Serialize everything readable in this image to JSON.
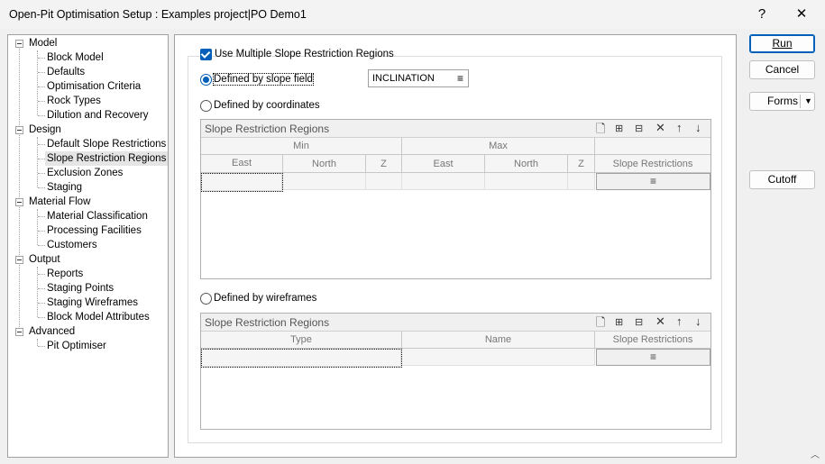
{
  "window": {
    "title": "Open-Pit Optimisation Setup : Examples project|PO Demo1",
    "help": "?",
    "close": "✕"
  },
  "tree": {
    "groups": [
      {
        "label": "Model",
        "items": [
          "Block Model",
          "Defaults",
          "Optimisation Criteria",
          "Rock Types",
          "Dilution and Recovery"
        ]
      },
      {
        "label": "Design",
        "items": [
          "Default Slope Restrictions",
          "Slope Restriction Regions",
          "Exclusion Zones",
          "Staging"
        ]
      },
      {
        "label": "Material Flow",
        "items": [
          "Material Classification",
          "Processing Facilities",
          "Customers"
        ]
      },
      {
        "label": "Output",
        "items": [
          "Reports",
          "Staging Points",
          "Staging Wireframes",
          "Block Model Attributes"
        ]
      },
      {
        "label": "Advanced",
        "items": [
          "Pit Optimiser"
        ]
      }
    ],
    "selected": "Slope Restriction Regions"
  },
  "form": {
    "use_multiple_label": "Use Multiple Slope Restriction Regions",
    "use_multiple_checked": true,
    "opt_slope_field": "Defined by slope field",
    "slope_field_value": "INCLINATION",
    "opt_coordinates": "Defined by coordinates",
    "opt_wireframes": "Defined by wireframes",
    "selected_option": "slope_field"
  },
  "coords_grid": {
    "title": "Slope Restriction Regions",
    "group_min": "Min",
    "group_max": "Max",
    "columns": [
      "East",
      "North",
      "Z",
      "East",
      "North",
      "Z",
      "Slope Restrictions"
    ],
    "list_icon": "≡"
  },
  "wire_grid": {
    "title": "Slope Restriction Regions",
    "columns": [
      "Type",
      "Name",
      "Slope Restrictions"
    ],
    "list_icon": "≡"
  },
  "buttons": {
    "run": "Run",
    "cancel": "Cancel",
    "forms": "Forms",
    "cutoff": "Cutoff"
  }
}
